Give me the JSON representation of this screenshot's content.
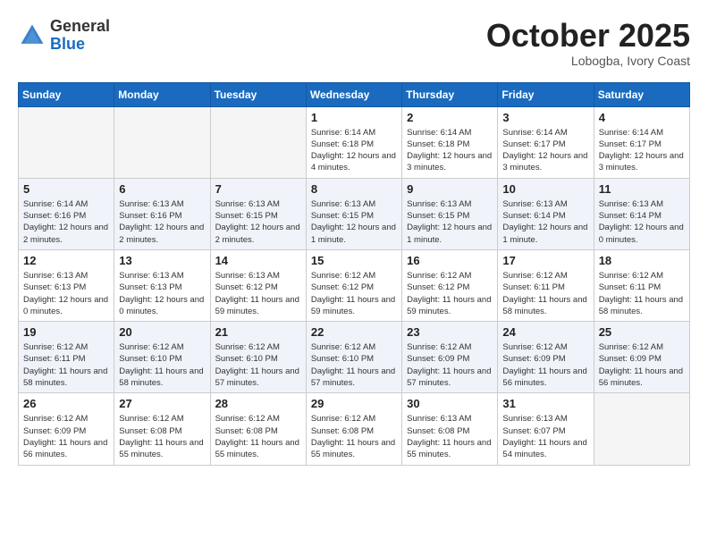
{
  "header": {
    "logo": {
      "general": "General",
      "blue": "Blue"
    },
    "title": "October 2025",
    "location": "Lobogba, Ivory Coast"
  },
  "weekdays": [
    "Sunday",
    "Monday",
    "Tuesday",
    "Wednesday",
    "Thursday",
    "Friday",
    "Saturday"
  ],
  "weeks": [
    [
      {
        "day": "",
        "sunrise": "",
        "sunset": "",
        "daylight": ""
      },
      {
        "day": "",
        "sunrise": "",
        "sunset": "",
        "daylight": ""
      },
      {
        "day": "",
        "sunrise": "",
        "sunset": "",
        "daylight": ""
      },
      {
        "day": "1",
        "sunrise": "Sunrise: 6:14 AM",
        "sunset": "Sunset: 6:18 PM",
        "daylight": "Daylight: 12 hours and 4 minutes."
      },
      {
        "day": "2",
        "sunrise": "Sunrise: 6:14 AM",
        "sunset": "Sunset: 6:18 PM",
        "daylight": "Daylight: 12 hours and 3 minutes."
      },
      {
        "day": "3",
        "sunrise": "Sunrise: 6:14 AM",
        "sunset": "Sunset: 6:17 PM",
        "daylight": "Daylight: 12 hours and 3 minutes."
      },
      {
        "day": "4",
        "sunrise": "Sunrise: 6:14 AM",
        "sunset": "Sunset: 6:17 PM",
        "daylight": "Daylight: 12 hours and 3 minutes."
      }
    ],
    [
      {
        "day": "5",
        "sunrise": "Sunrise: 6:14 AM",
        "sunset": "Sunset: 6:16 PM",
        "daylight": "Daylight: 12 hours and 2 minutes."
      },
      {
        "day": "6",
        "sunrise": "Sunrise: 6:13 AM",
        "sunset": "Sunset: 6:16 PM",
        "daylight": "Daylight: 12 hours and 2 minutes."
      },
      {
        "day": "7",
        "sunrise": "Sunrise: 6:13 AM",
        "sunset": "Sunset: 6:15 PM",
        "daylight": "Daylight: 12 hours and 2 minutes."
      },
      {
        "day": "8",
        "sunrise": "Sunrise: 6:13 AM",
        "sunset": "Sunset: 6:15 PM",
        "daylight": "Daylight: 12 hours and 1 minute."
      },
      {
        "day": "9",
        "sunrise": "Sunrise: 6:13 AM",
        "sunset": "Sunset: 6:15 PM",
        "daylight": "Daylight: 12 hours and 1 minute."
      },
      {
        "day": "10",
        "sunrise": "Sunrise: 6:13 AM",
        "sunset": "Sunset: 6:14 PM",
        "daylight": "Daylight: 12 hours and 1 minute."
      },
      {
        "day": "11",
        "sunrise": "Sunrise: 6:13 AM",
        "sunset": "Sunset: 6:14 PM",
        "daylight": "Daylight: 12 hours and 0 minutes."
      }
    ],
    [
      {
        "day": "12",
        "sunrise": "Sunrise: 6:13 AM",
        "sunset": "Sunset: 6:13 PM",
        "daylight": "Daylight: 12 hours and 0 minutes."
      },
      {
        "day": "13",
        "sunrise": "Sunrise: 6:13 AM",
        "sunset": "Sunset: 6:13 PM",
        "daylight": "Daylight: 12 hours and 0 minutes."
      },
      {
        "day": "14",
        "sunrise": "Sunrise: 6:13 AM",
        "sunset": "Sunset: 6:12 PM",
        "daylight": "Daylight: 11 hours and 59 minutes."
      },
      {
        "day": "15",
        "sunrise": "Sunrise: 6:12 AM",
        "sunset": "Sunset: 6:12 PM",
        "daylight": "Daylight: 11 hours and 59 minutes."
      },
      {
        "day": "16",
        "sunrise": "Sunrise: 6:12 AM",
        "sunset": "Sunset: 6:12 PM",
        "daylight": "Daylight: 11 hours and 59 minutes."
      },
      {
        "day": "17",
        "sunrise": "Sunrise: 6:12 AM",
        "sunset": "Sunset: 6:11 PM",
        "daylight": "Daylight: 11 hours and 58 minutes."
      },
      {
        "day": "18",
        "sunrise": "Sunrise: 6:12 AM",
        "sunset": "Sunset: 6:11 PM",
        "daylight": "Daylight: 11 hours and 58 minutes."
      }
    ],
    [
      {
        "day": "19",
        "sunrise": "Sunrise: 6:12 AM",
        "sunset": "Sunset: 6:11 PM",
        "daylight": "Daylight: 11 hours and 58 minutes."
      },
      {
        "day": "20",
        "sunrise": "Sunrise: 6:12 AM",
        "sunset": "Sunset: 6:10 PM",
        "daylight": "Daylight: 11 hours and 58 minutes."
      },
      {
        "day": "21",
        "sunrise": "Sunrise: 6:12 AM",
        "sunset": "Sunset: 6:10 PM",
        "daylight": "Daylight: 11 hours and 57 minutes."
      },
      {
        "day": "22",
        "sunrise": "Sunrise: 6:12 AM",
        "sunset": "Sunset: 6:10 PM",
        "daylight": "Daylight: 11 hours and 57 minutes."
      },
      {
        "day": "23",
        "sunrise": "Sunrise: 6:12 AM",
        "sunset": "Sunset: 6:09 PM",
        "daylight": "Daylight: 11 hours and 57 minutes."
      },
      {
        "day": "24",
        "sunrise": "Sunrise: 6:12 AM",
        "sunset": "Sunset: 6:09 PM",
        "daylight": "Daylight: 11 hours and 56 minutes."
      },
      {
        "day": "25",
        "sunrise": "Sunrise: 6:12 AM",
        "sunset": "Sunset: 6:09 PM",
        "daylight": "Daylight: 11 hours and 56 minutes."
      }
    ],
    [
      {
        "day": "26",
        "sunrise": "Sunrise: 6:12 AM",
        "sunset": "Sunset: 6:09 PM",
        "daylight": "Daylight: 11 hours and 56 minutes."
      },
      {
        "day": "27",
        "sunrise": "Sunrise: 6:12 AM",
        "sunset": "Sunset: 6:08 PM",
        "daylight": "Daylight: 11 hours and 55 minutes."
      },
      {
        "day": "28",
        "sunrise": "Sunrise: 6:12 AM",
        "sunset": "Sunset: 6:08 PM",
        "daylight": "Daylight: 11 hours and 55 minutes."
      },
      {
        "day": "29",
        "sunrise": "Sunrise: 6:12 AM",
        "sunset": "Sunset: 6:08 PM",
        "daylight": "Daylight: 11 hours and 55 minutes."
      },
      {
        "day": "30",
        "sunrise": "Sunrise: 6:13 AM",
        "sunset": "Sunset: 6:08 PM",
        "daylight": "Daylight: 11 hours and 55 minutes."
      },
      {
        "day": "31",
        "sunrise": "Sunrise: 6:13 AM",
        "sunset": "Sunset: 6:07 PM",
        "daylight": "Daylight: 11 hours and 54 minutes."
      },
      {
        "day": "",
        "sunrise": "",
        "sunset": "",
        "daylight": ""
      }
    ]
  ]
}
